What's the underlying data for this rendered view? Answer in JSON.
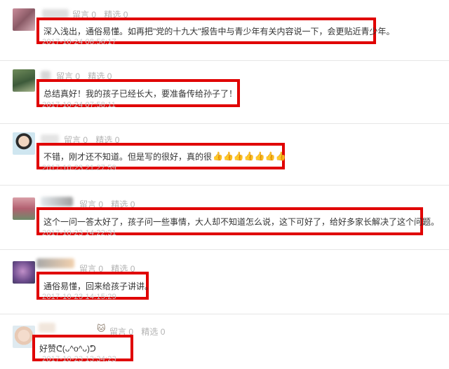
{
  "comments": [
    {
      "reply_label": "留言 0",
      "pick_label": "精选 0",
      "content": "深入浅出，通俗易懂。如再把\"党的十九大\"报告中与青少年有关内容说一下，会更贴近青少年。",
      "timestamp": "2017-10-24 08:56:17"
    },
    {
      "reply_label": "留言 0",
      "pick_label": "精选 0",
      "content": "总结真好！我的孩子已经长大，要准备传给孙子了！",
      "timestamp": "2017-10-24 07:58:11"
    },
    {
      "reply_label": "留言 0",
      "pick_label": "精选 0",
      "content": "不错，刚才还不知道。但是写的很好，真的很",
      "emoji": "👍👍👍👍👍👍👍",
      "timestamp": "2017-10-23 21:27:59"
    },
    {
      "reply_label": "留言 0",
      "pick_label": "精选 0",
      "content": "这个一问一答太好了，孩子问一些事情，大人却不知道怎么说，这下可好了，给好多家长解决了这个问题。",
      "timestamp": "2017-10-23 14:22:31"
    },
    {
      "reply_label": "留言 0",
      "pick_label": "精选 0",
      "content": "通俗易懂，回来给孩子讲讲。",
      "timestamp": "2017-10-23 14:15:29"
    },
    {
      "reply_label": "留言 0",
      "pick_label": "精选 0",
      "content": "好赞ᕦ(ᴗ^o^ᴗ)ᕤ",
      "timestamp": "2017-10-23 13:34:23"
    }
  ]
}
